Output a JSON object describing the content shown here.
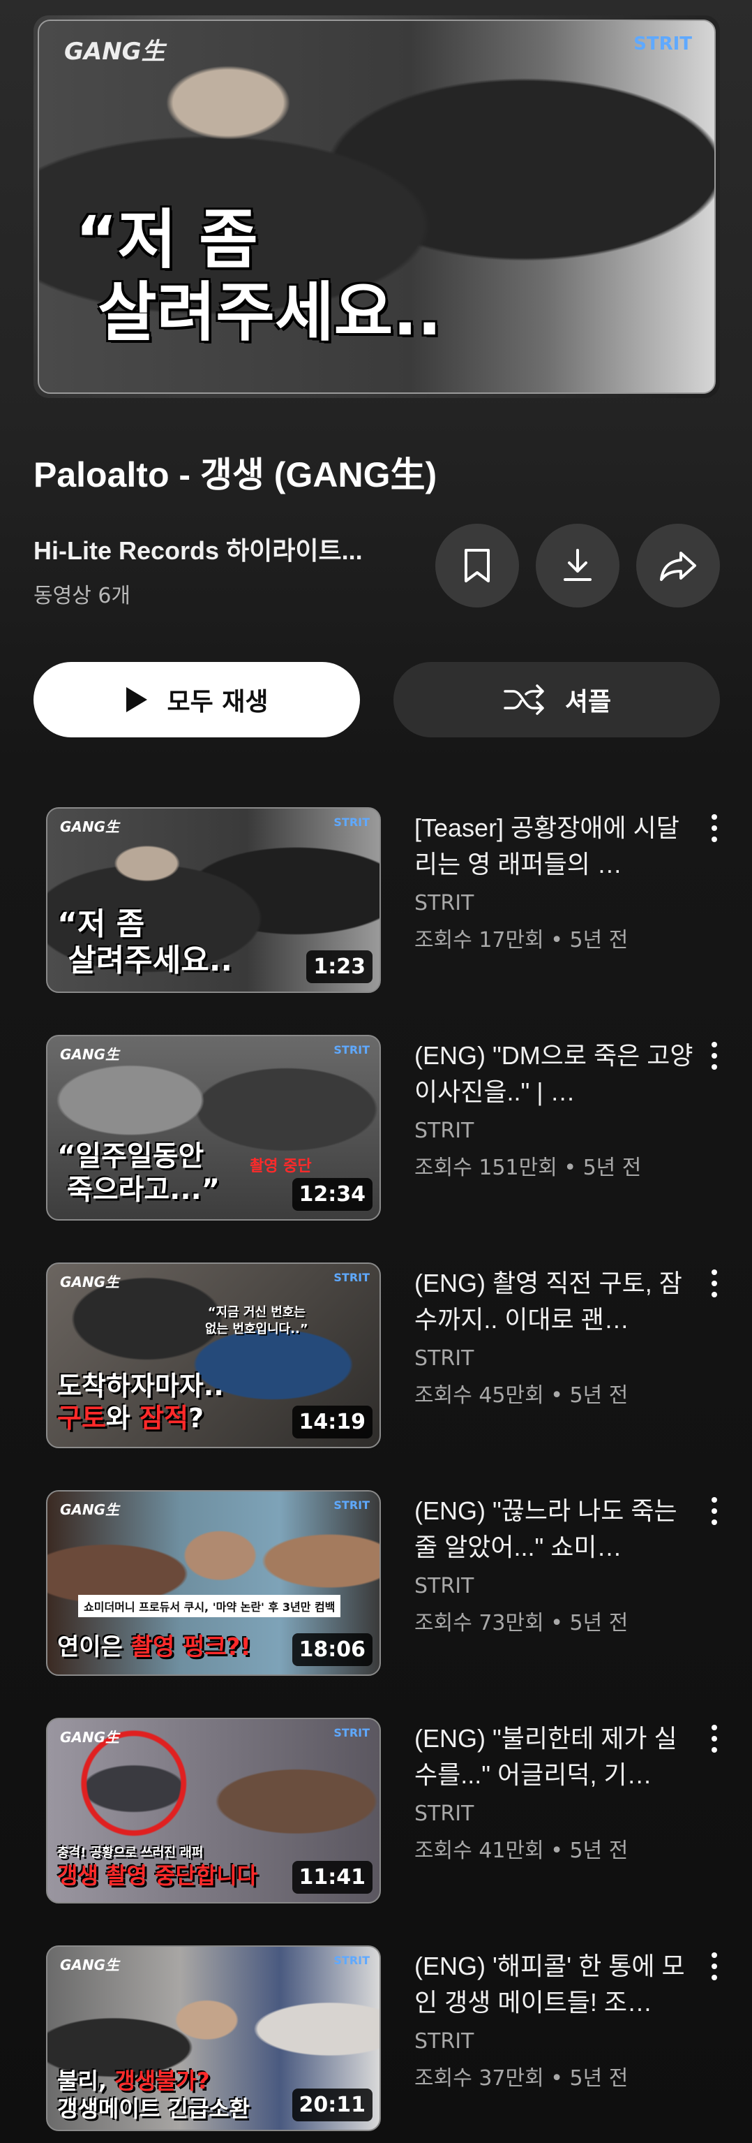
{
  "hero": {
    "brand": "GANG生",
    "brand2": "STRIT",
    "caption": "“저 좀\n 살려주세요..",
    "icon": "playlist-cover-image"
  },
  "playlist": {
    "title": "Paloalto - 갱생 (GANG生)",
    "channel": "Hi-Lite Records 하이라이트...",
    "count": "동영상 6개"
  },
  "actions": {
    "save_icon": "bookmark-icon",
    "download_icon": "download-icon",
    "share_icon": "share-icon",
    "play_all": "모두 재생",
    "shuffle": "셔플"
  },
  "videos": [
    {
      "title": "[Teaser] 공황장애에 시달리는 영 래퍼들의 …",
      "channel": "STRIT",
      "stats": "조회수 17만회 • 5년 전",
      "duration": "1:23",
      "thumb_caption": "“저 좀\n 살려주세요..",
      "thumb_brand": "GANG生",
      "thumb_brand2": "STRIT"
    },
    {
      "title": "(ENG) \"DM으로 죽은 고양이사진을..\" | …",
      "channel": "STRIT",
      "stats": "조회수 151만회 • 5년 전",
      "duration": "12:34",
      "thumb_caption": "“일주일동안\n 죽으라고...”",
      "thumb_sub": "촬영 중단",
      "thumb_brand": "GANG生",
      "thumb_brand2": "STRIT"
    },
    {
      "title": "(ENG) 촬영 직전 구토, 잠수까지.. 이대로 괜…",
      "channel": "STRIT",
      "stats": "조회수 45만회 • 5년 전",
      "duration": "14:19",
      "thumb_caption_a": "도착하자마자..",
      "thumb_caption_b1": "구토",
      "thumb_caption_b2": "와 ",
      "thumb_caption_b3": "잠적",
      "thumb_caption_b4": "?",
      "thumb_note": "“지금 거신 번호는\n없는 번호입니다..”",
      "thumb_brand": "GANG生",
      "thumb_brand2": "STRIT"
    },
    {
      "title": "(ENG) \"끊느라 나도 죽는 줄 알았어...\" 쇼미…",
      "channel": "STRIT",
      "stats": "조회수 73만회 • 5년 전",
      "duration": "18:06",
      "thumb_note": "쇼미더머니 프로듀서 쿠시, '마약 논란' 후 3년만 컴백",
      "thumb_caption_a": "연이은 ",
      "thumb_caption_b": "촬영 펑크",
      "thumb_caption_c": "?!",
      "thumb_brand": "GANG生",
      "thumb_brand2": "STRIT"
    },
    {
      "title": "(ENG) \"불리한테 제가 실수를...\" 어글리덕, 기…",
      "channel": "STRIT",
      "stats": "조회수 41만회 • 5년 전",
      "duration": "11:41",
      "thumb_note": "충격! 공황으로 쓰러진 래퍼",
      "thumb_caption_b": "갱생 촬영 중단합니다",
      "thumb_brand": "GANG生",
      "thumb_brand2": "STRIT"
    },
    {
      "title": "(ENG) '해피콜' 한 통에 모인 갱생 메이트들! 조…",
      "channel": "STRIT",
      "stats": "조회수 37만회 • 5년 전",
      "duration": "20:11",
      "thumb_caption_a": "불리, ",
      "thumb_caption_b": "갱생불가",
      "thumb_caption_c": "?",
      "thumb_caption_d": "갱생메이트 긴급소환",
      "thumb_brand": "GANG生",
      "thumb_brand2": "STRIT"
    }
  ],
  "colors": {
    "accent_red": "#ff2a2a",
    "brand_blue": "#5fa9ff",
    "pill_white": "#ffffff",
    "pill_dark": "#2f2f2f"
  }
}
